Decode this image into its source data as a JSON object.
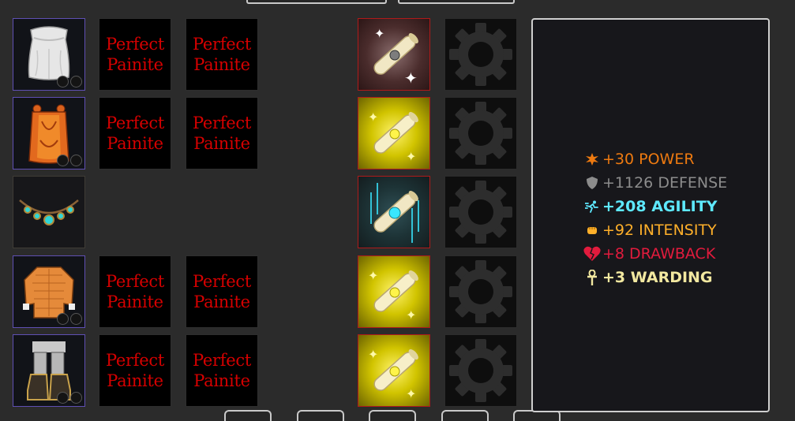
{
  "gem_label_line1": "Perfect",
  "gem_label_line2": "Painite",
  "equipment": [
    {
      "icon": "cape-icon"
    },
    {
      "icon": "robe-icon"
    },
    {
      "icon": "necklace-icon"
    },
    {
      "icon": "jacket-icon"
    },
    {
      "icon": "boots-icon"
    }
  ],
  "enchant_scrolls": [
    {
      "icon": "scroll-icon",
      "glow": "#ffffff"
    },
    {
      "icon": "scroll-icon",
      "glow": "#fff200"
    },
    {
      "icon": "scroll-icon",
      "glow": "#39e6ff"
    },
    {
      "icon": "scroll-icon",
      "glow": "#fff200"
    },
    {
      "icon": "scroll-icon",
      "glow": "#fff200"
    }
  ],
  "stats": {
    "power": "+30 POWER",
    "defense": "+1126 DEFENSE",
    "agility": "+208 AGILITY",
    "intensity": "+92 INTENSITY",
    "drawback": "+8 DRAWBACK",
    "warding": "+3 WARDING"
  },
  "colors": {
    "power": "#ee7a10",
    "defense": "#8c8c8c",
    "agility": "#5ee9ff",
    "intensity": "#ffb02a",
    "drawback": "#e21b3d",
    "warding": "#f2e8a0",
    "gem_text": "#d50000",
    "equip_border": "#5f4fb3",
    "scroll_border": "#b01a1a"
  }
}
